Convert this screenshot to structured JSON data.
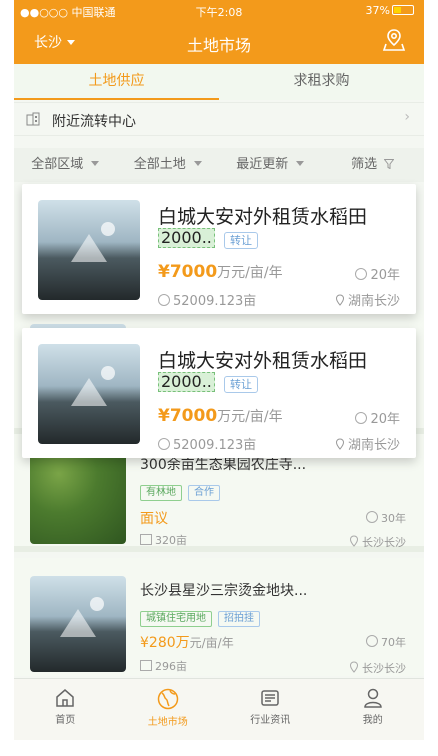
{
  "status": {
    "carrier": "●●○○○ 中国联通",
    "time": "下午2:08",
    "battery": "37%"
  },
  "header": {
    "city": "长沙",
    "title": "土地市场"
  },
  "tabs": [
    {
      "label": "土地供应"
    },
    {
      "label": "求租求购"
    }
  ],
  "nearby": {
    "label": "附近流转中心"
  },
  "filters": [
    {
      "label": "全部区域"
    },
    {
      "label": "全部土地"
    },
    {
      "label": "最近更新"
    },
    {
      "label": "筛选"
    }
  ],
  "cards": [
    {
      "name": "白城大安对外租赁水稻田",
      "code": "2000..",
      "tag": "转让",
      "price": "¥7000",
      "unit": "万元/亩/年",
      "years": "20年",
      "area": "52009.123亩",
      "location": "湖南长沙"
    },
    {
      "name": "白城大安对外租赁水稻田",
      "code": "2000..",
      "tag": "转让",
      "price": "¥7000",
      "unit": "万元/亩/年",
      "years": "20年",
      "area": "52009.123亩",
      "location": "湖南长沙"
    }
  ],
  "items": [
    {
      "name": "300余亩生态果园农庄寺...",
      "tags": [
        "有林地",
        "合作"
      ],
      "price": "面议",
      "unit": "",
      "years": "30年",
      "area": "320亩",
      "location": "长沙长沙"
    },
    {
      "name": "长沙县星沙三宗烫金地块...",
      "tags": [
        "城镇住宅用地",
        "招拍挂"
      ],
      "price": "¥280万",
      "unit": "元/亩/年",
      "years": "70年",
      "area": "296亩",
      "location": "长沙长沙"
    }
  ],
  "bottom_nav": [
    {
      "label": "首页"
    },
    {
      "label": "土地市场"
    },
    {
      "label": "行业资讯"
    },
    {
      "label": "我的"
    }
  ],
  "colors": {
    "brand": "#f39a1b",
    "tag_green": "#5aa85e",
    "tag_blue": "#6a9fd4"
  }
}
